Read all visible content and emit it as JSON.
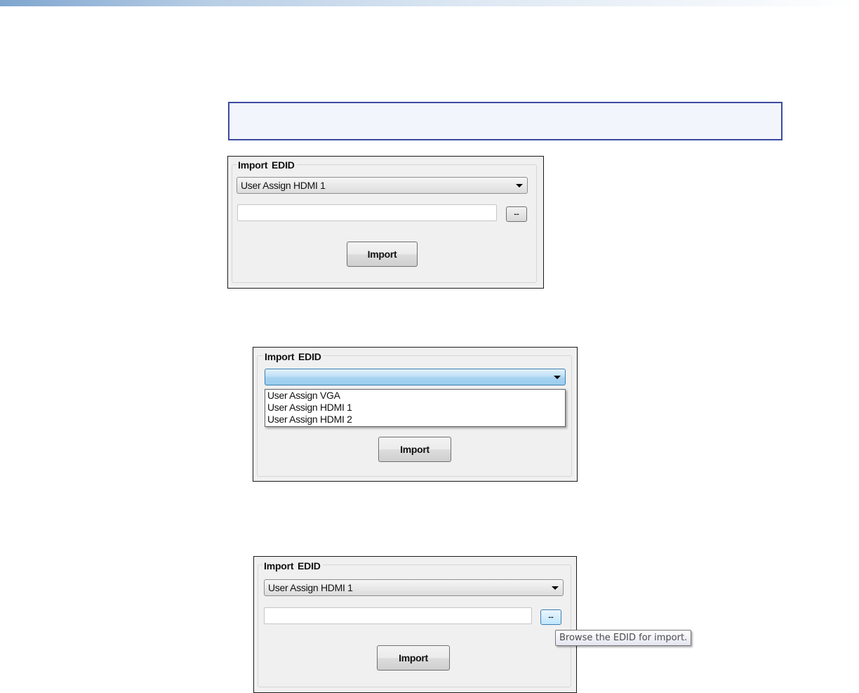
{
  "panels": [
    {
      "legend": "Import  EDID",
      "combo_value": "User Assign HDMI 1",
      "browse_label": "--",
      "import_label": "Import"
    },
    {
      "legend": "Import  EDID",
      "combo_value": "",
      "options": [
        "User Assign VGA",
        "User Assign HDMI 1",
        "User Assign HDMI 2"
      ],
      "import_label": "Import"
    },
    {
      "legend": "Import  EDID",
      "combo_value": "User Assign HDMI 1",
      "browse_label": "--",
      "import_label": "Import",
      "tooltip": "Browse the EDID for import."
    }
  ]
}
